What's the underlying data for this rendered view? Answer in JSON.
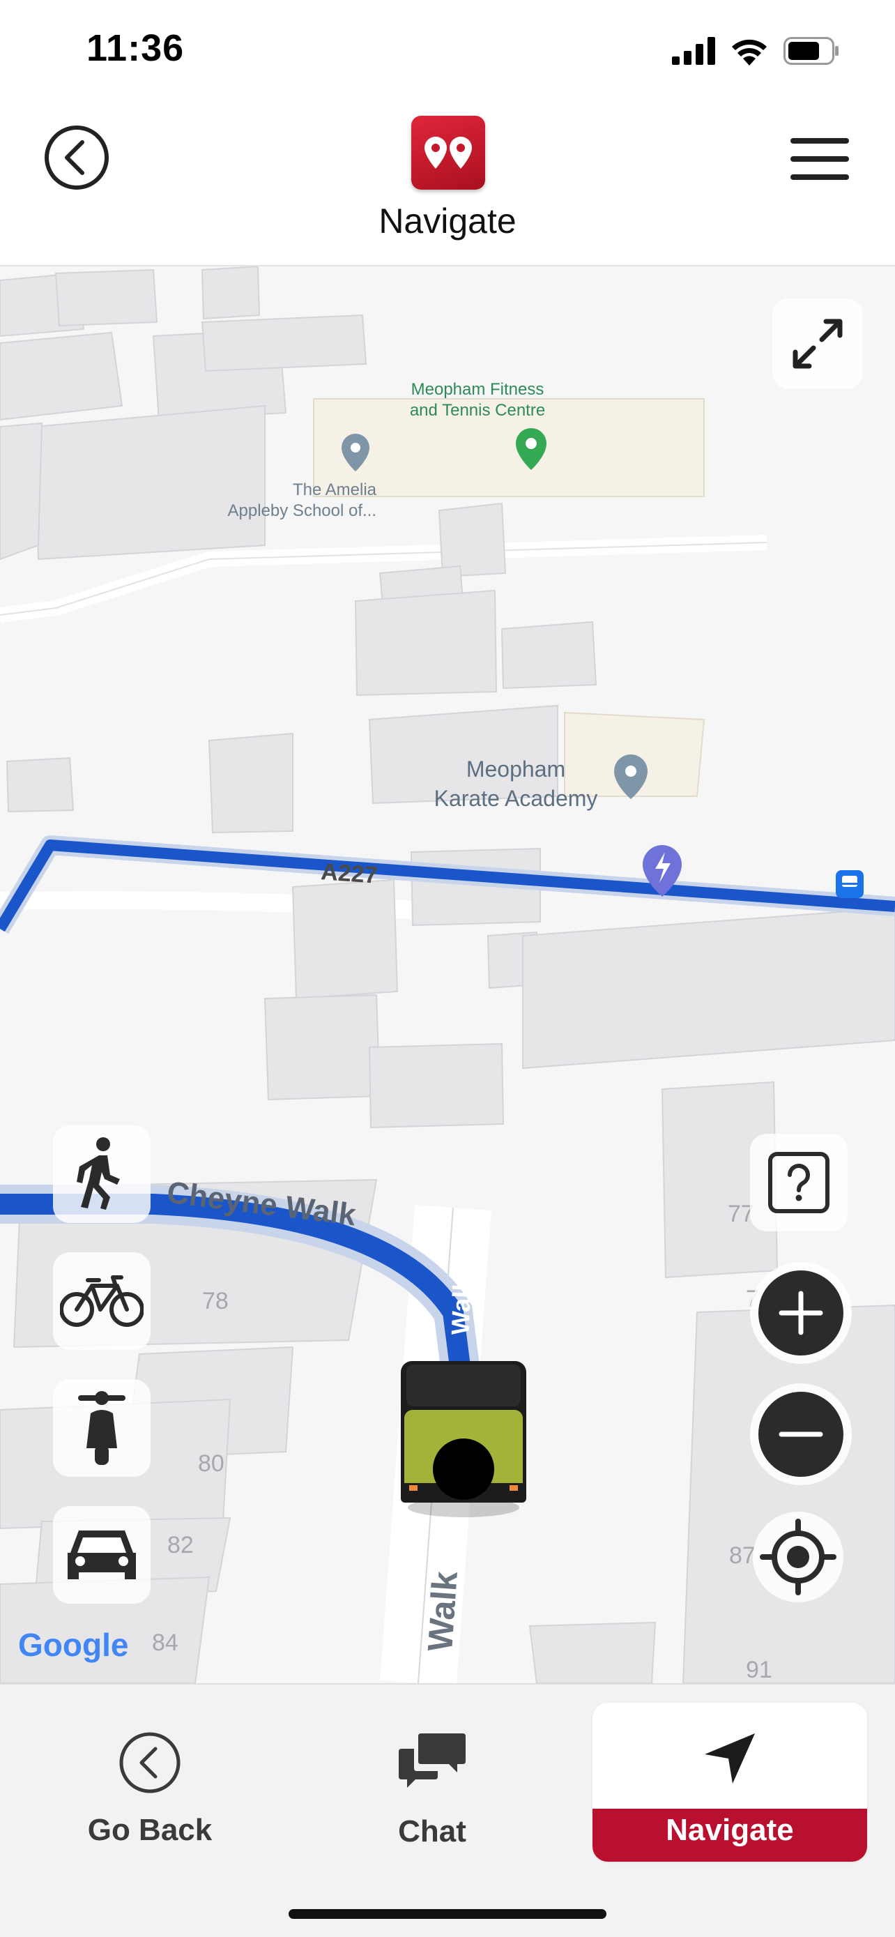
{
  "status_bar": {
    "time": "11:36"
  },
  "header": {
    "title": "Navigate"
  },
  "map": {
    "pois": {
      "fitness": "Meopham Fitness\nand Tennis Centre",
      "school": "The Amelia\nAppleby School of...",
      "karate": "Meopham\nKarate Academy"
    },
    "roads": {
      "a227": "A227",
      "cheyne_walk": "Cheyne Walk",
      "walk_upper": "Walk",
      "walk_lower": "Walk"
    },
    "house_numbers": {
      "n77": "77",
      "n78": "78",
      "n7": "7",
      "n80": "80",
      "n82": "82",
      "n84": "84",
      "n87": "87",
      "n91": "91"
    },
    "attribution": "Google",
    "travel_modes": [
      "walk-icon",
      "bicycle-icon",
      "scooter-icon",
      "car-icon"
    ],
    "colors": {
      "route": "#1a56c9",
      "accent": "#b8102e",
      "poi_green": "#34a853",
      "poi_gray": "#7f95a8",
      "charging": "#6f72d8"
    }
  },
  "bottom_nav": {
    "go_back": "Go Back",
    "chat": "Chat",
    "navigate": "Navigate"
  }
}
